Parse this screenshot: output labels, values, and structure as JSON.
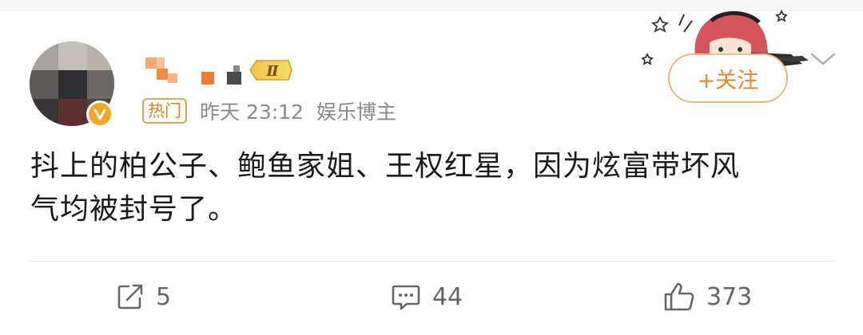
{
  "post": {
    "username_badge": "Ⅱ",
    "hot_tag": "热门",
    "time": "昨天 23:12",
    "role": "娱乐博主",
    "follow_label": "+关注",
    "text_line1": "抖上的柏公子、鲍鱼家姐、王权红星，因为炫富带坏风",
    "text_line2": "气均被封号了。"
  },
  "actions": {
    "repost_count": "5",
    "comment_count": "44",
    "like_count": "373"
  },
  "colors": {
    "accent_orange": "#e8862a",
    "follow_border": "#e8ba7f",
    "verified": "#f6a623",
    "hot_tag": "#c98a33",
    "meta_gray": "#8a8a8a"
  },
  "icons": [
    "verified-v-icon",
    "level-badge-icon",
    "chevron-down-icon",
    "repost-icon",
    "comment-icon",
    "like-icon"
  ]
}
